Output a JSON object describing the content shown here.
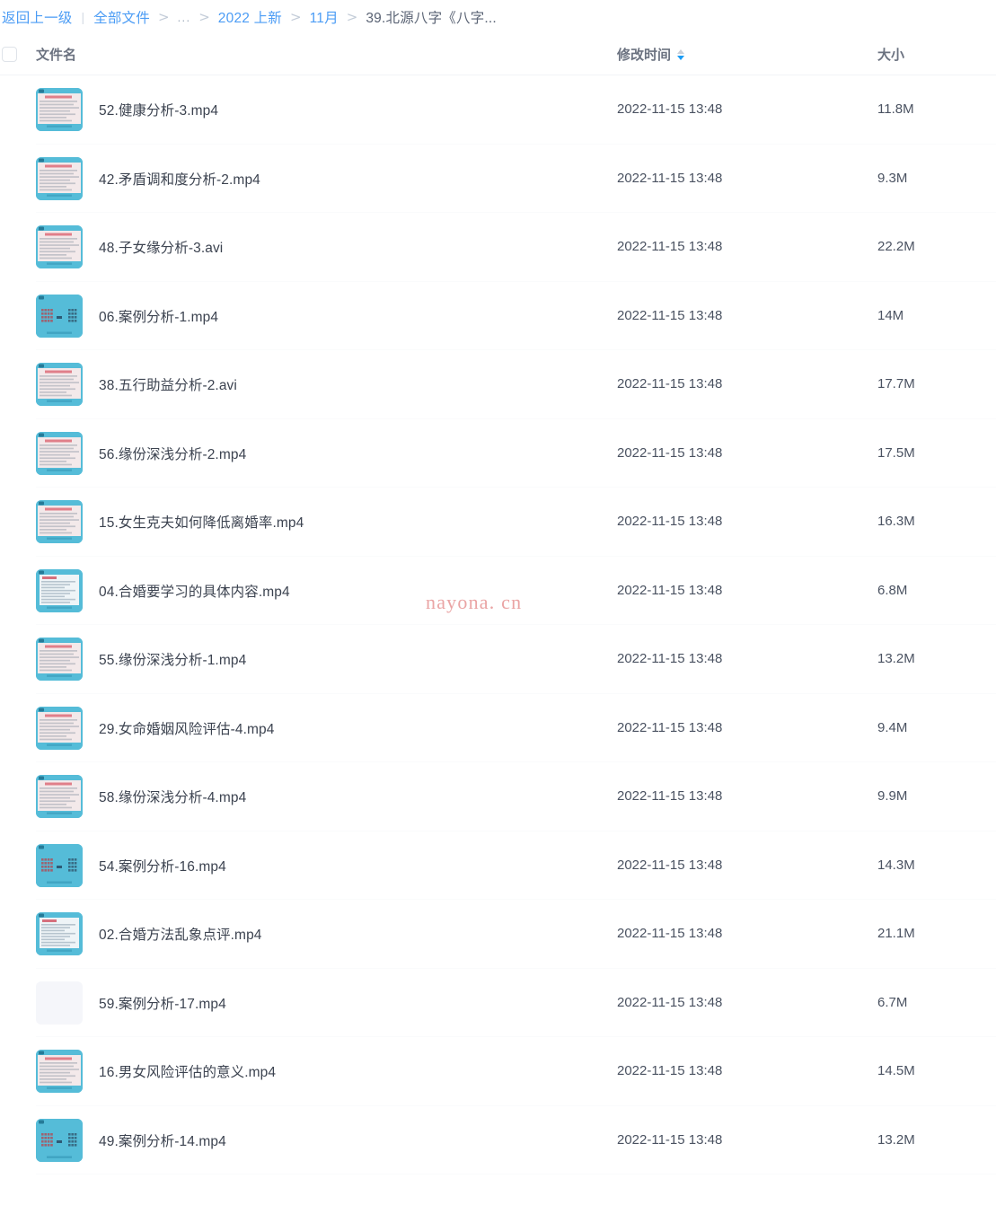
{
  "breadcrumb": {
    "back_label": "返回上一级",
    "divider": "|",
    "separator": ">",
    "ellipsis": "...",
    "root_label": "全部文件",
    "segment_year": "2022 上新",
    "segment_month": "11月",
    "current": "39.北源八字《八字..."
  },
  "table": {
    "columns": {
      "name": "文件名",
      "time": "修改时间",
      "size": "大小"
    },
    "sort": {
      "column": "修改时间",
      "direction": "desc",
      "asc_arrow_color": "#c9cfd8",
      "desc_arrow_color": "#1a9cf5"
    },
    "select_all_checked": false,
    "rows": [
      {
        "name": "52.健康分析-3.mp4",
        "time": "2022-11-15 13:48",
        "size": "11.8M",
        "thumb": "video-thumb-doc",
        "type": "mp4"
      },
      {
        "name": "42.矛盾调和度分析-2.mp4",
        "time": "2022-11-15 13:48",
        "size": "9.3M",
        "thumb": "video-thumb-doc",
        "type": "mp4"
      },
      {
        "name": "48.子女缘分析-3.avi",
        "time": "2022-11-15 13:48",
        "size": "22.2M",
        "thumb": "video-thumb-doc",
        "type": "avi"
      },
      {
        "name": "06.案例分析-1.mp4",
        "time": "2022-11-15 13:48",
        "size": "14M",
        "thumb": "video-thumb-chart",
        "type": "mp4"
      },
      {
        "name": "38.五行助益分析-2.avi",
        "time": "2022-11-15 13:48",
        "size": "17.7M",
        "thumb": "video-thumb-doc",
        "type": "avi"
      },
      {
        "name": "56.缘份深浅分析-2.mp4",
        "time": "2022-11-15 13:48",
        "size": "17.5M",
        "thumb": "video-thumb-doc",
        "type": "mp4"
      },
      {
        "name": "15.女生克夫如何降低离婚率.mp4",
        "time": "2022-11-15 13:48",
        "size": "16.3M",
        "thumb": "video-thumb-doc",
        "type": "mp4"
      },
      {
        "name": "04.合婚要学习的具体内容.mp4",
        "time": "2022-11-15 13:48",
        "size": "6.8M",
        "thumb": "video-thumb-list",
        "type": "mp4"
      },
      {
        "name": "55.缘份深浅分析-1.mp4",
        "time": "2022-11-15 13:48",
        "size": "13.2M",
        "thumb": "video-thumb-doc",
        "type": "mp4"
      },
      {
        "name": "29.女命婚姻风险评估-4.mp4",
        "time": "2022-11-15 13:48",
        "size": "9.4M",
        "thumb": "video-thumb-doc",
        "type": "mp4"
      },
      {
        "name": "58.缘份深浅分析-4.mp4",
        "time": "2022-11-15 13:48",
        "size": "9.9M",
        "thumb": "video-thumb-doc",
        "type": "mp4"
      },
      {
        "name": "54.案例分析-16.mp4",
        "time": "2022-11-15 13:48",
        "size": "14.3M",
        "thumb": "video-thumb-chart",
        "type": "mp4"
      },
      {
        "name": "02.合婚方法乱象点评.mp4",
        "time": "2022-11-15 13:48",
        "size": "21.1M",
        "thumb": "video-thumb-list",
        "type": "mp4"
      },
      {
        "name": "59.案例分析-17.mp4",
        "time": "2022-11-15 13:48",
        "size": "6.7M",
        "thumb": "blank",
        "type": "mp4"
      },
      {
        "name": "16.男女风险评估的意义.mp4",
        "time": "2022-11-15 13:48",
        "size": "14.5M",
        "thumb": "video-thumb-doc",
        "type": "mp4"
      },
      {
        "name": "49.案例分析-14.mp4",
        "time": "2022-11-15 13:48",
        "size": "13.2M",
        "thumb": "video-thumb-chart",
        "type": "mp4"
      }
    ]
  },
  "watermark": {
    "text": "nayona. cn",
    "color": "#eaa4a4"
  },
  "theme": {
    "link_blue": "#4b9cf5",
    "accent_blue": "#1a9cf5",
    "thumb_cyan": "#55bcd8",
    "text_dark": "#3c4350",
    "text_muted": "#6b7280"
  }
}
